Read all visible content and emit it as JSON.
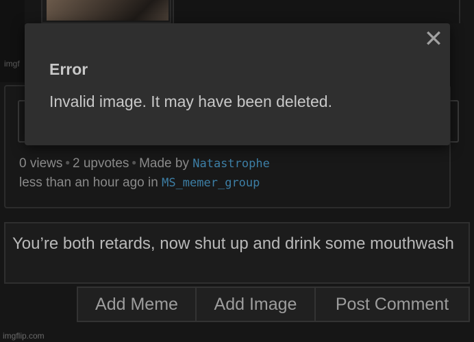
{
  "watermark": {
    "top": "imgf",
    "bottom": "imgflip.com"
  },
  "meme_info": {
    "views": "0 views",
    "upvotes": "2 upvotes",
    "made_by_label": "Made by",
    "author": "Natastrophe",
    "time_label": "less than an hour ago in",
    "group": "MS_memer_group",
    "separator": "•"
  },
  "comment": {
    "text": "You’re both retards, now shut up and drink some mouthwash"
  },
  "buttons": {
    "add_meme": "Add Meme",
    "add_image": "Add Image",
    "post_comment": "Post Comment"
  },
  "error_modal": {
    "title": "Error",
    "message": "Invalid image. It may have been deleted.",
    "close_icon": "close-icon",
    "close_glyph": "✕"
  },
  "colors": {
    "link": "#3d7fa6",
    "modal_bg": "#2f2f2f",
    "page_bg": "#161616"
  }
}
